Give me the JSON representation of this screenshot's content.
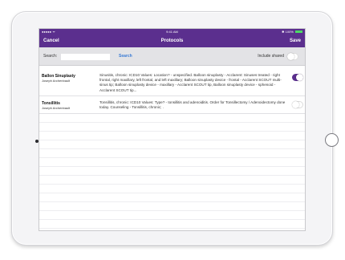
{
  "status_bar": {
    "signal": "●●●●● ᯤ",
    "time": "9:41 AM",
    "battery_text": "✱ 100%"
  },
  "nav": {
    "cancel_label": "Cancel",
    "title": "Protocols",
    "save_label": "Save",
    "background_color": "#5b2f8e"
  },
  "search": {
    "label": "Search:",
    "value": "",
    "placeholder": "",
    "button_label": "Search",
    "include_shared_label": "Include shared",
    "include_shared_on": false
  },
  "protocols": [
    {
      "name": "Ballon Sinuplasty",
      "author": "Joseph Archenbault",
      "description": "Sinusitis, chronic: ICD10 Values: Location? - unspecified. Balloon sinuplasty - Acclarent: Sinuses treated - right frontal, right maxillary, left frontal, and left maxillary; Balloon sinuplasty device - frontal - Acclarent SCOUT multi-sinus tip; Balloon sinuplasty device - maxillary - Acclarent SCOUT tip, Balloon sinuplasty device - sphenoid - Acclarent SCOUT tip...",
      "selected": true
    },
    {
      "name": "Tonsillitis",
      "author": "Joseph Archenbault",
      "description": "Tonsillitis, chronic: ICD10 Values: Type? - tonsillitis and adenoiditis. Order for Tonsillectomy / Adenoidectomy done today. Counseling - Tonsillitis, chronic; .",
      "selected": false
    }
  ]
}
